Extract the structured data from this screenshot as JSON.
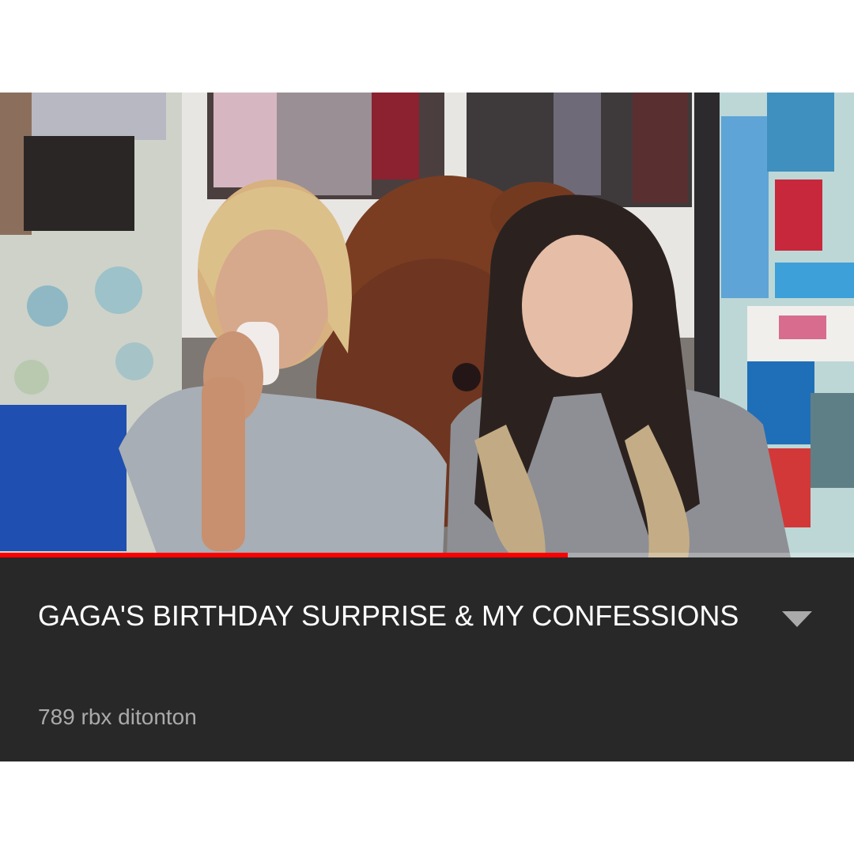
{
  "video": {
    "title": "GAGA'S BIRTHDAY SURPRISE & MY CONFESSIONS",
    "views": "789 rbx ditonton",
    "progress": 0.665
  },
  "icons": {
    "expand": "chevron-down-icon"
  },
  "colors": {
    "panel_background": "#282828",
    "title_text": "#ffffff",
    "meta_text": "#aaaaaa",
    "progress_played": "#ff0000"
  }
}
